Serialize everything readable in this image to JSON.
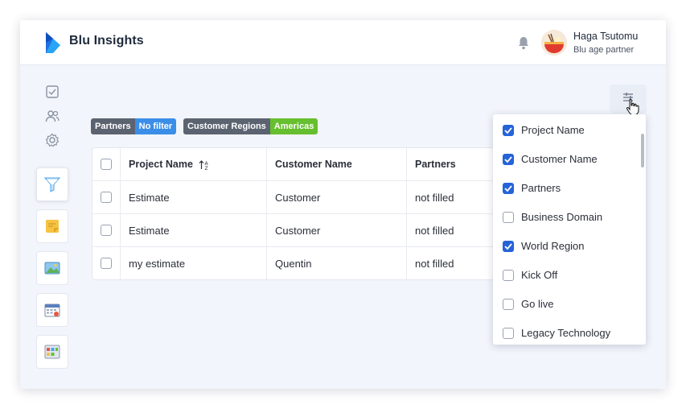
{
  "header": {
    "brand": "Blu Insights",
    "user_name": "Haga Tsutomu",
    "user_role": "Blu age partner"
  },
  "sidebar": {
    "icons": [
      "checklist-icon",
      "users-icon",
      "settings-icon"
    ],
    "buttons": [
      "funnel-icon",
      "sticky-note-icon",
      "picture-icon",
      "calendar-icon",
      "board-icon"
    ]
  },
  "filters": [
    {
      "key": "Partners",
      "value": "No filter",
      "color": "#3b8ee8"
    },
    {
      "key": "Customer Regions",
      "value": "Americas",
      "color": "#66bf2e"
    }
  ],
  "table": {
    "columns": [
      "Project Name",
      "Customer Name",
      "Partners"
    ],
    "rows": [
      [
        "Estimate",
        "Customer",
        "not filled"
      ],
      [
        "Estimate",
        "Customer",
        "not filled"
      ],
      [
        "my estimate",
        "Quentin",
        "not filled"
      ]
    ]
  },
  "column_menu": {
    "items": [
      {
        "label": "Project Name",
        "checked": true
      },
      {
        "label": "Customer Name",
        "checked": true
      },
      {
        "label": "Partners",
        "checked": true
      },
      {
        "label": "Business Domain",
        "checked": false
      },
      {
        "label": "World Region",
        "checked": true
      },
      {
        "label": "Kick Off",
        "checked": false
      },
      {
        "label": "Go live",
        "checked": false
      },
      {
        "label": "Legacy Technology",
        "checked": false
      }
    ]
  },
  "colors": {
    "accent": "#2563d9",
    "background": "#f2f5fb"
  }
}
